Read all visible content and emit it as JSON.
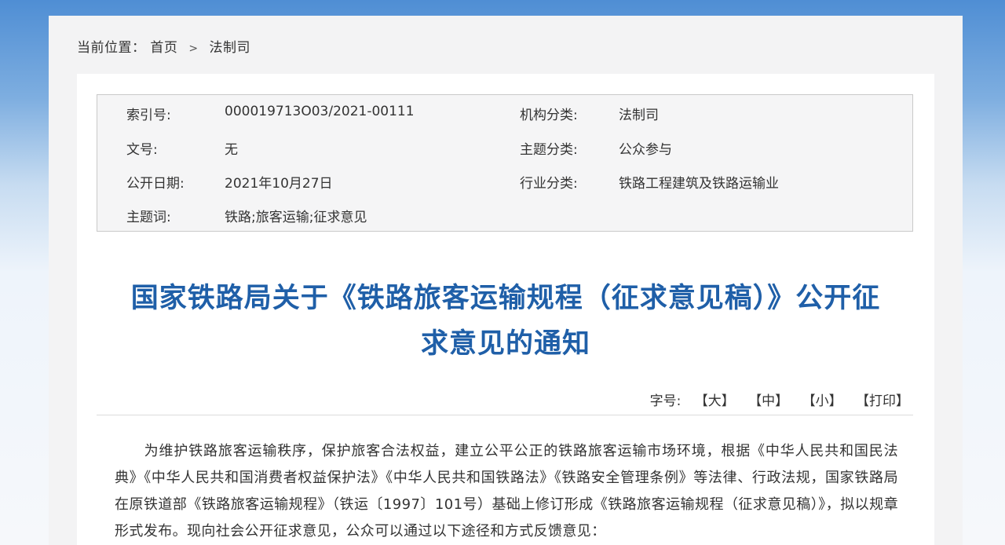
{
  "breadcrumb": {
    "label": "当前位置：",
    "home": "首页",
    "separator": ">",
    "current": "法制司"
  },
  "meta": {
    "index_label": "索引号:",
    "index_value": "000019713O03/2021-00111",
    "org_label": "机构分类:",
    "org_value": "法制司",
    "docno_label": "文号:",
    "docno_value": "无",
    "topic_label": "主题分类:",
    "topic_value": "公众参与",
    "date_label": "公开日期:",
    "date_value": "2021年10月27日",
    "industry_label": "行业分类:",
    "industry_value": "铁路工程建筑及铁路运输业",
    "keywords_label": "主题词:",
    "keywords_value": "铁路;旅客运输;征求意见"
  },
  "title": {
    "line1": "国家铁路局关于《铁路旅客运输规程（征求意见稿）》公开征",
    "line2": "求意见的通知"
  },
  "toolbar": {
    "font_label": "字号:",
    "large": "【大】",
    "medium": "【中】",
    "small": "【小】",
    "print": "【打印】"
  },
  "body": {
    "paragraph1": "　　为维护铁路旅客运输秩序，保护旅客合法权益，建立公平公正的铁路旅客运输市场环境，根据《中华人民共和国民法典》《中华人民共和国消费者权益保护法》《中华人民共和国铁路法》《铁路安全管理条例》等法律、行政法规，国家铁路局在原铁道部《铁路旅客运输规程》（铁运〔1997〕101号）基础上修订形成《铁路旅客运输规程（征求意见稿）》，拟以规章形式发布。现向社会公开征求意见，公众可以通过以下途径和方式反馈意见："
  },
  "colors": {
    "title": "#1f5fa8",
    "header_gradient_top": "#4f8ed4"
  }
}
